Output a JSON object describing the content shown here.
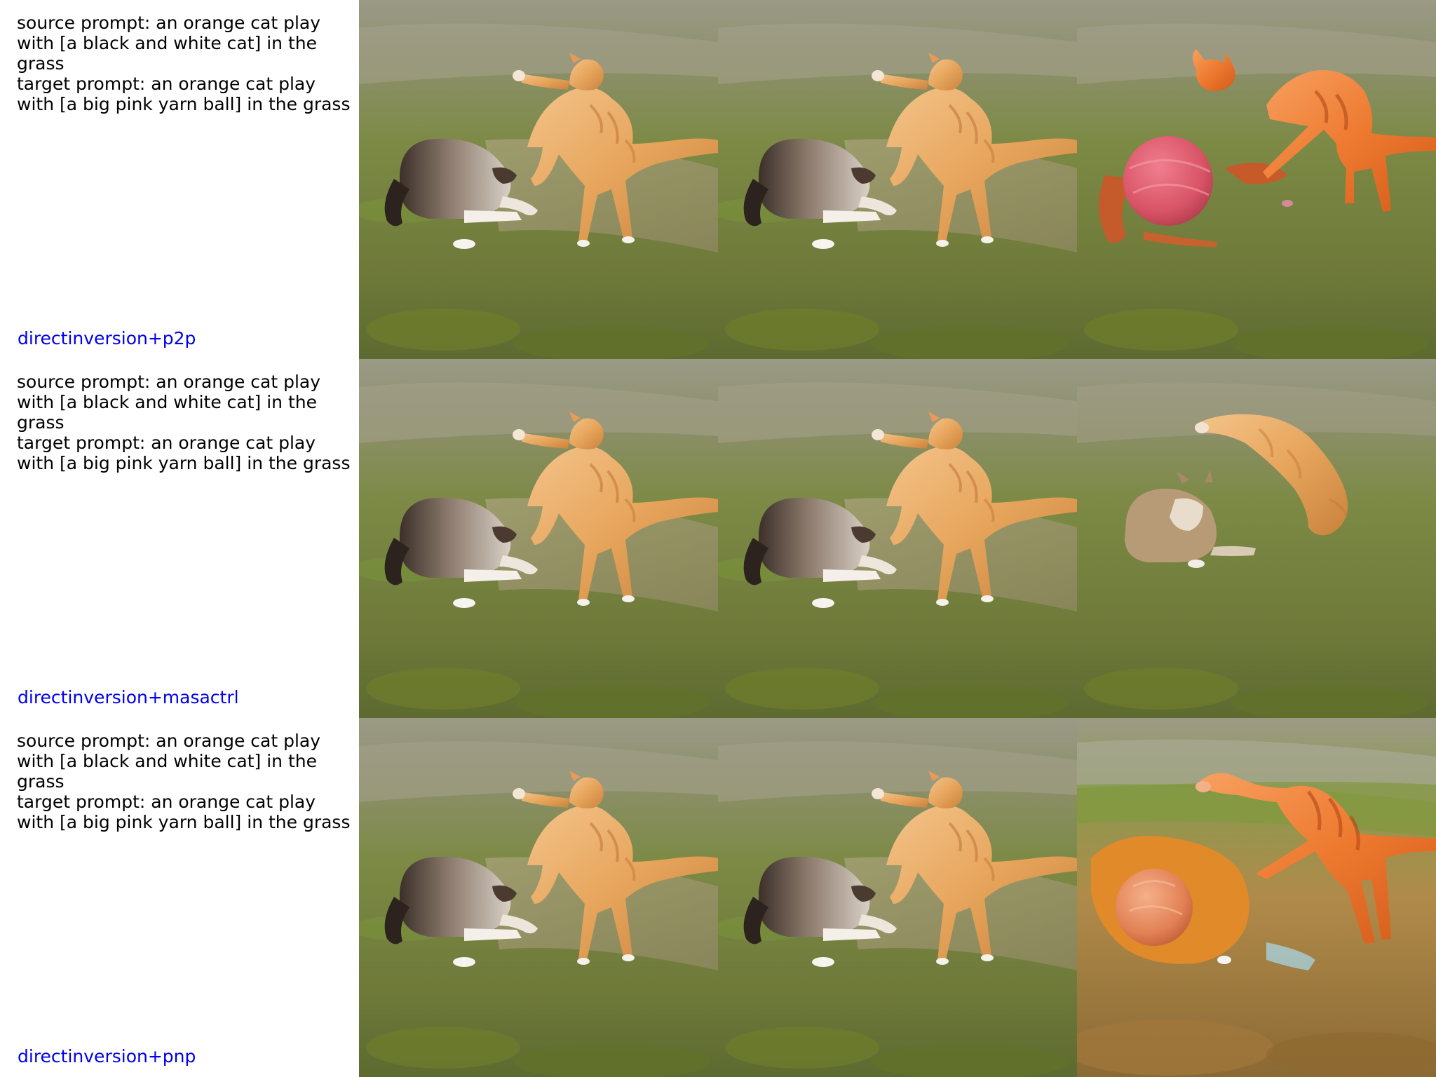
{
  "rows": [
    {
      "source_prompt": "source prompt: an orange cat play with [a black and white cat] in the grass",
      "target_prompt": "target prompt: an orange cat play with [a big pink yarn ball] in the grass",
      "method": "directinversion+p2p"
    },
    {
      "source_prompt": "source prompt: an orange cat play with [a black and white cat] in the grass",
      "target_prompt": "target prompt: an orange cat play with [a big pink yarn ball] in the grass",
      "method": "directinversion+masactrl"
    },
    {
      "source_prompt": "source prompt: an orange cat play with [a black and white cat] in the grass",
      "target_prompt": "target prompt: an orange cat play with [a big pink yarn ball] in the grass",
      "method": "directinversion+pnp"
    }
  ],
  "colors": {
    "label_text": "#000000",
    "method_text": "#0000ee",
    "background": "#ffffff"
  }
}
